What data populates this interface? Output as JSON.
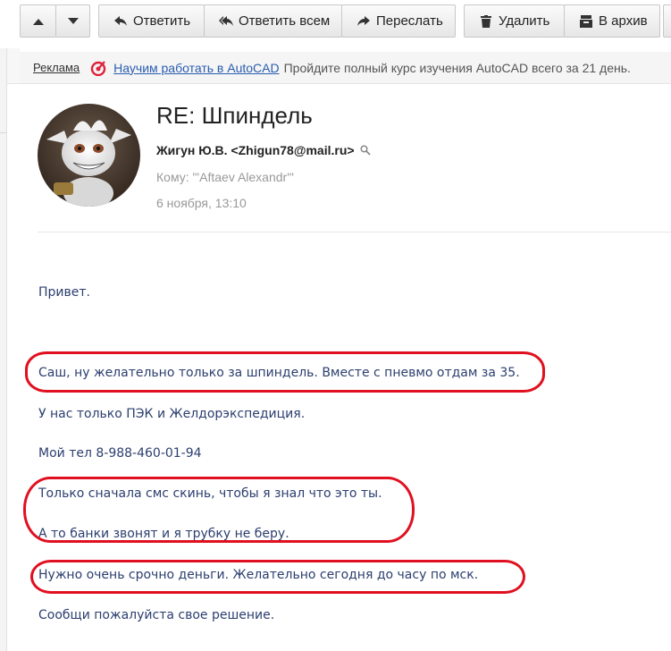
{
  "toolbar": {
    "reply": "Ответить",
    "reply_all": "Ответить всем",
    "forward": "Переслать",
    "delete": "Удалить",
    "archive": "В архив"
  },
  "ad": {
    "label": "Реклама",
    "title": "Научим работать в AutoCAD",
    "text": "Пройдите полный курс изучения AutoCAD всего за 21 день."
  },
  "message": {
    "subject": "RE: Шпиндель",
    "from": "Жигун Ю.В. <Zhigun78@mail.ru>",
    "to": "Кому: \"'Aftaev Alexandr'\"",
    "date": "6 ноября, 13:10",
    "body": [
      "Привет.",
      "Саш, ну желательно только за шпиндель. Вместе с пневмо отдам за 35.",
      "У нас только ПЭК и Желдорэкспедиция.",
      "Мой тел 8-988-460-01-94",
      "Только сначала смс скинь, чтобы я знал что это ты.",
      "А то банки звонят и я трубку не беру.",
      "Нужно очень срочно деньги. Желательно сегодня до часу по мск.",
      "Сообщи пожалуйста свое решение."
    ]
  },
  "colors": {
    "annotation": "#e01020",
    "body_text": "#2b3e6e",
    "link": "#2a5db0"
  }
}
